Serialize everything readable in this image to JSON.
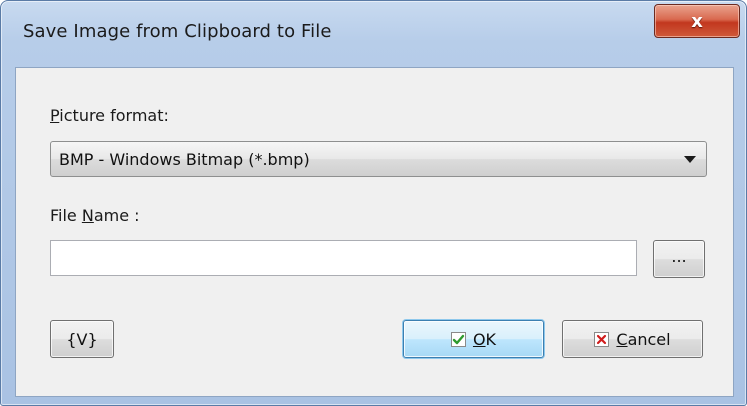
{
  "window": {
    "title": "Save Image from Clipboard to File",
    "close_glyph": "x"
  },
  "form": {
    "picture_format_label_accel": "P",
    "picture_format_label_rest": "icture format:",
    "picture_format_value": "BMP - Windows Bitmap (*.bmp)",
    "file_name_label_pre": "File ",
    "file_name_label_accel": "N",
    "file_name_label_rest": "ame :",
    "file_name_value": "",
    "browse_label": "..."
  },
  "buttons": {
    "variables_label": "{V}",
    "ok_accel": "O",
    "ok_rest": "K",
    "cancel_accel": "C",
    "cancel_rest": "ancel"
  },
  "colors": {
    "ok_check": "#2e9a2e",
    "cancel_x": "#d01c1c",
    "close_button": "#c2371e"
  },
  "icons": {
    "ok": "check-icon",
    "cancel": "cross-icon",
    "combo": "chevron-down-icon"
  }
}
